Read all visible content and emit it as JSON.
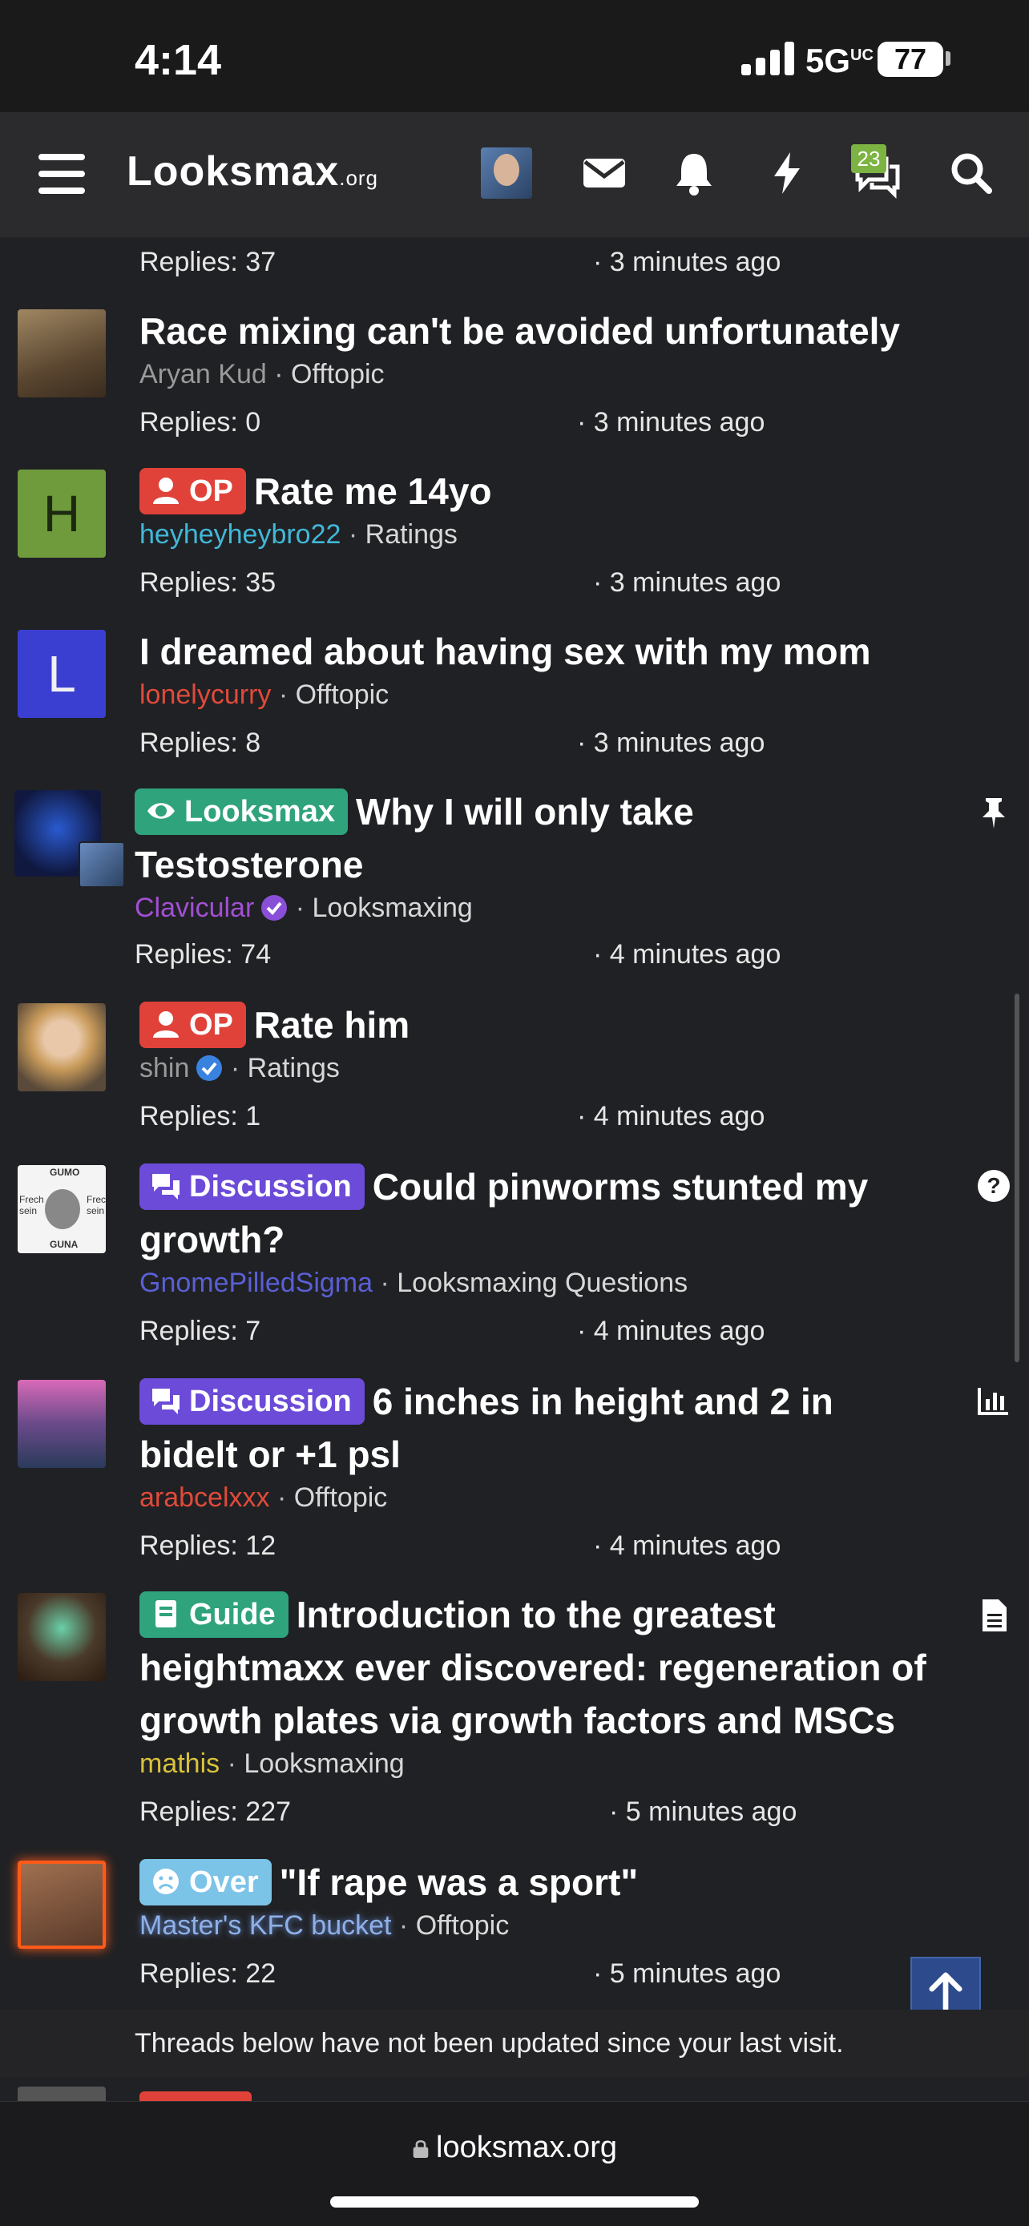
{
  "status_bar": {
    "time": "4:14",
    "network": "5G",
    "network_sup": "UC",
    "battery": "77"
  },
  "header": {
    "logo_main": "Looksmax",
    "logo_suffix": ".org",
    "conversations_badge": "23"
  },
  "partial_top": {
    "replies": "Replies: 37",
    "time": "· 3 minutes ago"
  },
  "threads": [
    {
      "title": "Race mixing can't be avoided unfortunately",
      "prefix": "",
      "author": "Aryan Kud",
      "author_color": "#9a9a9a",
      "forum": "Offtopic",
      "replies": "Replies: 0",
      "time": "· 3 minutes ago",
      "avatar_letter": "",
      "avatar_color": "#6d5a44"
    },
    {
      "title": "Rate me 14yo",
      "prefix": "OP",
      "author": "heyheyheybro22",
      "author_color": "#41b8d8",
      "forum": "Ratings",
      "replies": "Replies: 35",
      "time": "· 3 minutes ago",
      "avatar_letter": "H",
      "avatar_color": "#6f9b3c"
    },
    {
      "title": "I dreamed about having sex with my mom",
      "prefix": "",
      "author": "lonelycurry",
      "author_color": "#e04a3a",
      "forum": "Offtopic",
      "replies": "Replies: 8",
      "time": "· 3 minutes ago",
      "avatar_letter": "L",
      "avatar_color": "#3b3fd1"
    },
    {
      "title_line1": "Why I will only take",
      "title_line2": "Testosterone",
      "prefix": "Looksmax",
      "author": "Clavicular",
      "author_color": "#a24fd4",
      "forum": "Looksmaxing",
      "replies": "Replies: 74",
      "time": "· 4 minutes ago"
    },
    {
      "title": "Rate him",
      "prefix": "OP",
      "author": "shin",
      "author_color": "#9a9a9a",
      "forum": "Ratings",
      "replies": "Replies: 1",
      "time": "· 4 minutes ago"
    },
    {
      "title_line1": "Could pinworms stunted my",
      "title_line2": "growth?",
      "prefix": "Discussion",
      "author": "GnomePilledSigma",
      "author_color": "#5a5fd6",
      "forum": "Looksmaxing Questions",
      "replies": "Replies: 7",
      "time": "· 4 minutes ago",
      "avatar_text_top": "GUMO",
      "avatar_text_left": "Frech sein",
      "avatar_text_right": "Frech sein",
      "avatar_text_bottom": "GUNA"
    },
    {
      "title_line1": "6 inches in height and 2 in",
      "title_line2": "bidelt or +1 psl",
      "prefix": "Discussion",
      "author": "arabcelxxx",
      "author_color": "#e04a3a",
      "forum": "Offtopic",
      "replies": "Replies: 12",
      "time": "· 4 minutes ago"
    },
    {
      "title_line1": "Introduction to the greatest",
      "title_line2": "heightmaxx ever discovered: regeneration of",
      "title_line3": "growth plates via growth factors and MSCs",
      "prefix": "Guide",
      "author": "mathis",
      "author_color": "#d9c23a",
      "forum": "Looksmaxing",
      "replies": "Replies: 227",
      "time": "· 5 minutes ago"
    },
    {
      "title": "\"If rape was a sport\"",
      "prefix": "Over",
      "author": "Master's KFC bucket",
      "author_color": "#8fb0e8",
      "forum": "Offtopic",
      "replies": "Replies: 22",
      "time": "· 5 minutes ago"
    }
  ],
  "unread_note": "Threads below have not been updated since your last visit.",
  "url_bar": {
    "domain": "looksmax.org"
  },
  "colors": {
    "op": "#e0423a",
    "looksmax": "#2fa37c",
    "discussion": "#6b4bd8",
    "guide": "#2fa37c",
    "over": "#7cc3e8"
  }
}
